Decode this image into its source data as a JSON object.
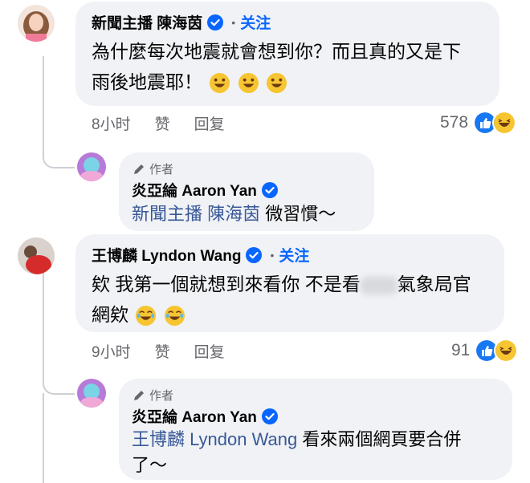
{
  "comments": [
    {
      "name": "新聞主播 陳海茵",
      "follow": "关注",
      "text_line1": "為什麼每次地震就會想到你？而且真的又是下",
      "text_line2": "雨後地震耶！",
      "time": "8小时",
      "like": "赞",
      "reply": "回复",
      "reaction_count": "578"
    },
    {
      "author_tag": "作者",
      "name": "炎亞綸 Aaron Yan",
      "mention": "新聞主播 陳海茵",
      "text": "微習慣～"
    },
    {
      "name": "王博麟 Lyndon Wang",
      "follow": "关注",
      "text_a": "欸 我第一個就想到來看你 不是看",
      "blurred": "中央",
      "text_b": "氣象局官",
      "text_line2": "網欸",
      "time": "9小时",
      "like": "赞",
      "reply": "回复",
      "reaction_count": "91"
    },
    {
      "author_tag": "作者",
      "name": "炎亞綸 Aaron Yan",
      "mention": "王博麟 Lyndon Wang",
      "text_a": "看來兩個網頁要合併",
      "text_line2": "了～"
    }
  ],
  "colors": {
    "accent": "#0866ff",
    "bubble": "#f0f2f5",
    "meta": "#65676b",
    "mention": "#385898"
  }
}
